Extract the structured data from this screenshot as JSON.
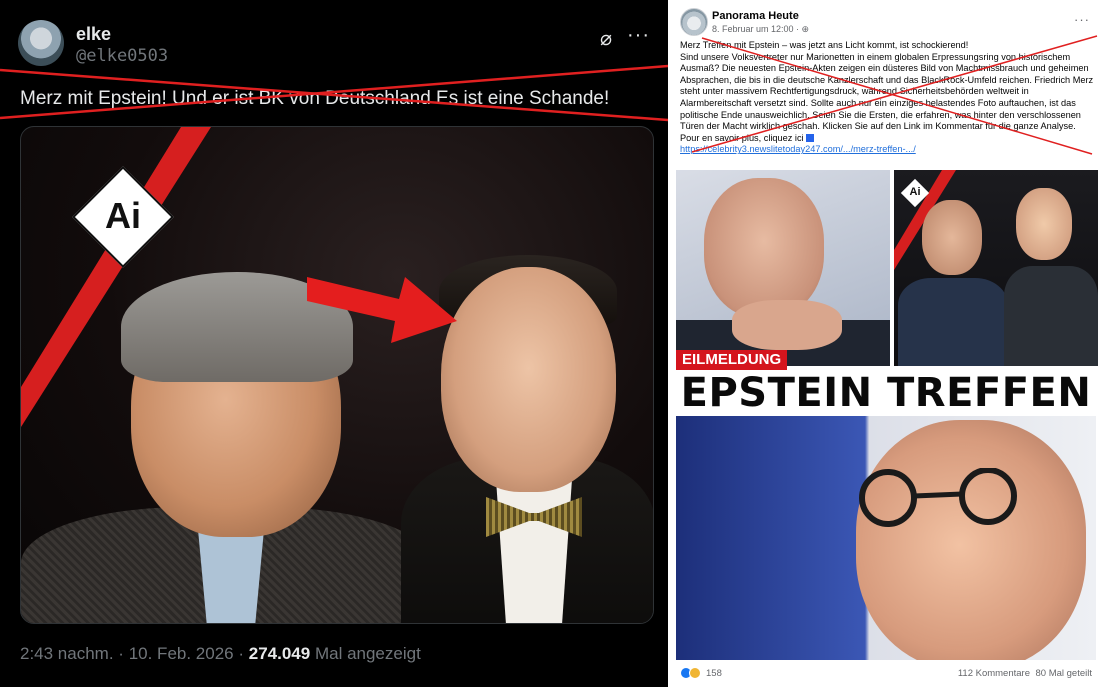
{
  "x_post": {
    "display_name": "elke",
    "handle": "@elke0503",
    "grok_icon": "grok-slash-circle-icon",
    "more_icon": "ellipsis-icon",
    "text": "Merz mit Epstein! Und er ist BK von Deutschland Es ist eine Schande!",
    "image": {
      "badge_text": "Ai",
      "arrow_color": "#e41e1e",
      "stripe_color": "#d61f1f"
    },
    "meta": {
      "time": "2:43 nachm.",
      "separator": "·",
      "date": "10. Feb. 2026",
      "views_count": "274.049",
      "views_label": "Mal angezeigt"
    }
  },
  "fb_post": {
    "page_name": "Panorama Heute",
    "date": "8. Februar um 12:00 · ",
    "privacy_icon": "globe-icon",
    "more_icon": "ellipsis-icon",
    "body_line1": "Merz Treffen mit Epstein – was jetzt ans Licht kommt, ist schockierend!",
    "body_line2": "Sind unsere Volksvertreter nur Marionetten in einem globalen Erpressungsring von historischem Ausmaß? Die neuesten Epstein-Akten zeigen ein düsteres Bild von Machtmissbrauch und geheimen Absprachen, die bis in die deutsche Kanzlerschaft und das BlackRock-Umfeld reichen. Friedrich Merz steht unter massivem Rechtfertigungsdruck, während Sicherheitsbehörden weltweit in Alarmbereitschaft versetzt sind. Sollte auch nur ein einziges belastendes Foto auftauchen, ist das politische Ende unausweichlich. Seien Sie die Ersten, die erfahren, was hinter den verschlossenen Türen der Macht wirklich geschah. Klicken Sie auf den Link im Kommentar für die ganze Analyse.",
    "body_line3": "Pour en savoir plus, cliquez ici",
    "link": "https://celebrity3.newslitetoday247.com/.../merz-treffen-.../",
    "image": {
      "badge_text": "Ai",
      "breaking_label": "EILMELDUNG",
      "headline": "EPSTEIN TREFFEN"
    },
    "footer": {
      "reaction_icons": [
        "like-icon",
        "angry-icon"
      ],
      "reactions_count": "158",
      "comments": "112 Kommentare",
      "shares": "80 Mal geteilt"
    }
  },
  "colors": {
    "x_background": "#000000",
    "x_text": "#e7e9ea",
    "x_secondary": "#71767b",
    "fb_link": "#216fdb",
    "strike_red": "#e02020",
    "breaking_red": "#d4151d"
  }
}
